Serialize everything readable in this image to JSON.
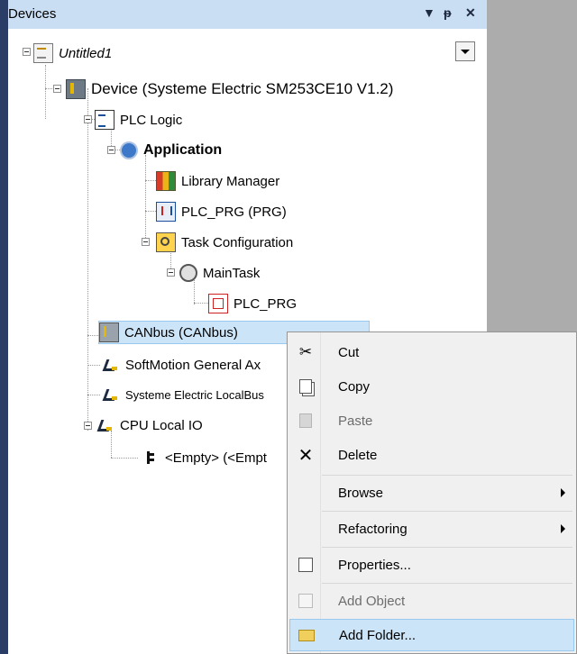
{
  "panel": {
    "title": "Devices",
    "dropdown_icon": "chevron-down-icon",
    "pin_icon": "pin-icon",
    "close_icon": "close-icon",
    "colors": {
      "titlebar": "#c9ddf3",
      "left_border": "#2a3d66",
      "background_area": "#acacac"
    }
  },
  "tree": {
    "project": "Untitled1",
    "device": "Device (Systeme Electric SM253CE10 V1.2)",
    "plc_logic": "PLC Logic",
    "application": "Application",
    "library_manager": "Library Manager",
    "plc_prg": "PLC_PRG (PRG)",
    "task_configuration": "Task Configuration",
    "main_task": "MainTask",
    "main_task_prg": "PLC_PRG",
    "canbus": "CANbus (CANbus)",
    "softmotion": "SoftMotion General Ax",
    "localbus": "Systeme Electric LocalBus",
    "cpu_local_io": "CPU Local IO",
    "empty_slot": "<Empty> (<Empt"
  },
  "context_menu": {
    "items": [
      {
        "label": "Cut",
        "icon": "cut-icon"
      },
      {
        "label": "Copy",
        "icon": "copy-icon"
      },
      {
        "label": "Paste",
        "icon": "paste-icon",
        "disabled": true
      },
      {
        "label": "Delete",
        "icon": "delete-icon"
      },
      {
        "label": "Browse",
        "submenu": true
      },
      {
        "label": "Refactoring",
        "submenu": true
      },
      {
        "label": "Properties...",
        "icon": "properties-icon"
      },
      {
        "label": "Add Object",
        "icon": "add-object-icon",
        "disabled": true
      },
      {
        "label": "Add Folder...",
        "icon": "folder-icon",
        "highlighted": true
      }
    ]
  }
}
